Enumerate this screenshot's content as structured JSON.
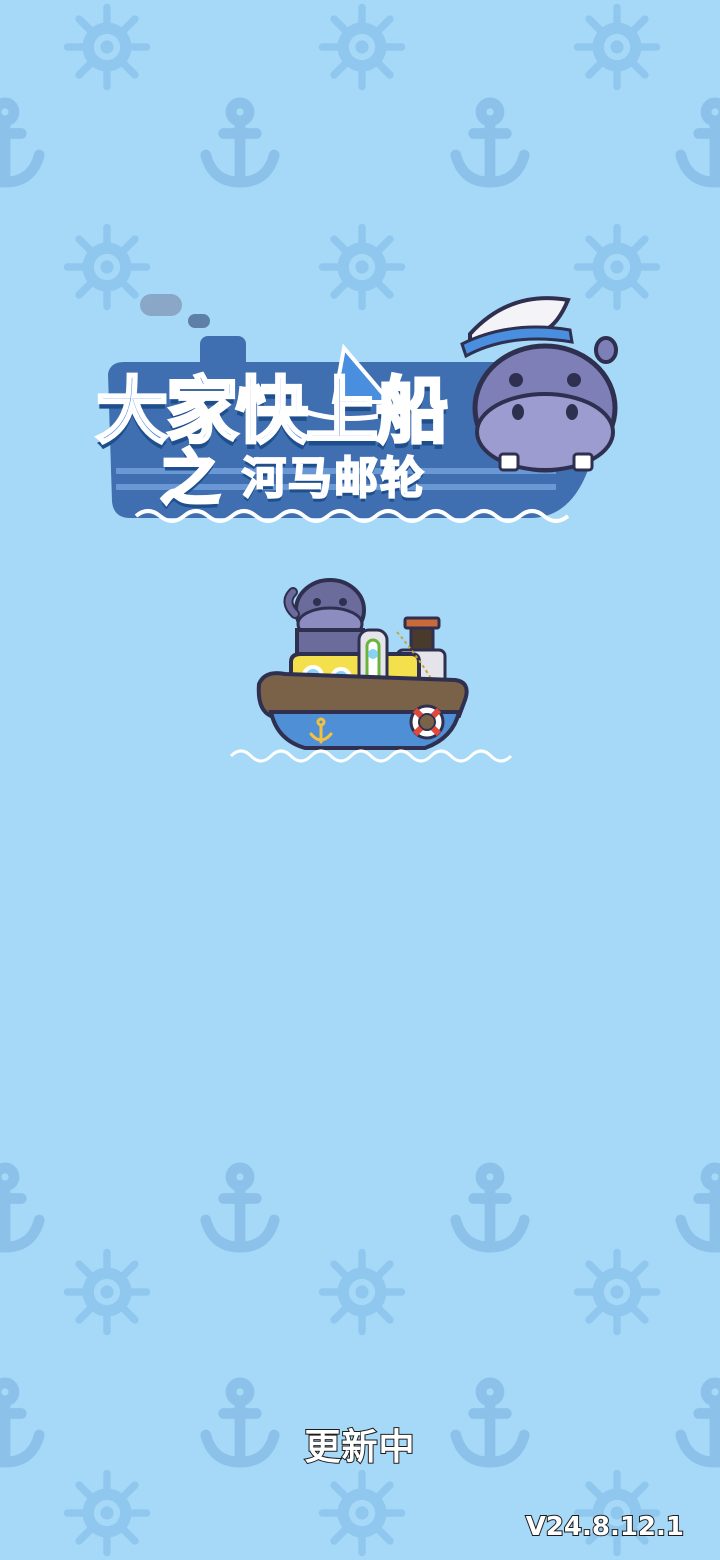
{
  "game": {
    "title_main": "大家快上船",
    "title_connector": "之",
    "title_sub": "河马邮轮"
  },
  "status": {
    "loading_text": "更新中",
    "version": "V24.8.12.1"
  },
  "background": {
    "color": "#a6d9f7",
    "pattern_icons": [
      "ship-wheel-icon",
      "anchor-icon"
    ]
  },
  "colors": {
    "title_blue": "#3a7fd9",
    "title_yellow": "#f6c43e",
    "hippo_purple": "#7f7fb8",
    "boat_yellow": "#f4e04d",
    "boat_blue": "#4f8fd6",
    "boat_brown": "#6e5840"
  }
}
